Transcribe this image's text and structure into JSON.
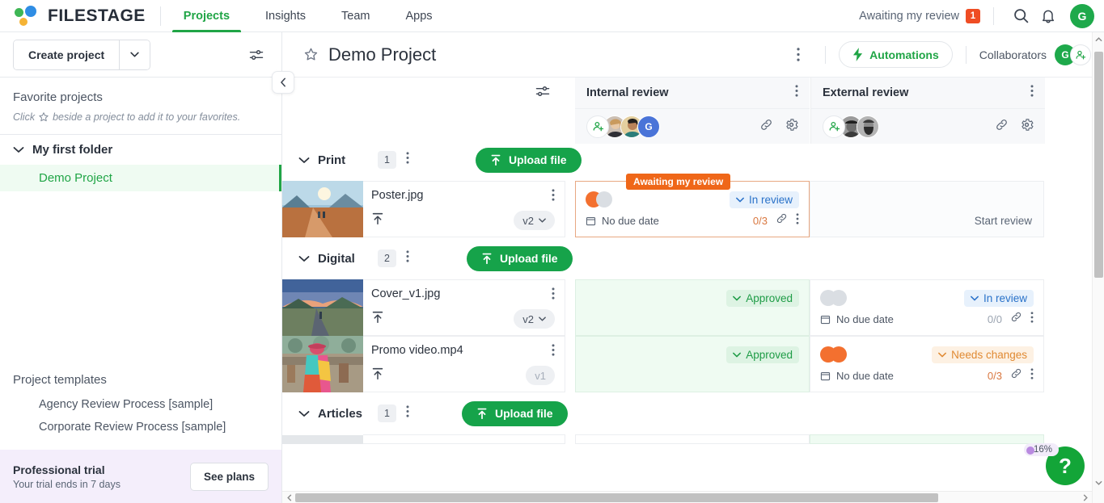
{
  "topbar": {
    "logo_text": "FILESTAGE",
    "nav": [
      {
        "label": "Projects",
        "active": true
      },
      {
        "label": "Insights",
        "active": false
      },
      {
        "label": "Team",
        "active": false
      },
      {
        "label": "Apps",
        "active": false
      }
    ],
    "awaiting_label": "Awaiting my review",
    "awaiting_count": "1",
    "avatar_initial": "G"
  },
  "sidebar": {
    "create_label": "Create project",
    "favorites_title": "Favorite projects",
    "favorites_hint_before": "Click",
    "favorites_hint_after": "beside a project to add it to your favorites.",
    "folder_label": "My first folder",
    "project_label": "Demo Project",
    "templates_title": "Project templates",
    "templates": [
      {
        "label": "Agency Review Process [sample]"
      },
      {
        "label": "Corporate Review Process [sample]"
      }
    ],
    "trial_title": "Professional trial",
    "trial_subtitle": "Your trial ends in 7 days",
    "see_plans_label": "See plans"
  },
  "project": {
    "title": "Demo Project",
    "automations_label": "Automations",
    "collaborators_label": "Collaborators",
    "collaborator_initial": "G"
  },
  "steps": [
    {
      "title": "Internal review",
      "avatar_initial": "G"
    },
    {
      "title": "External review"
    }
  ],
  "sections": [
    {
      "name": "Print",
      "count": "1",
      "upload_label": "Upload file",
      "files": [
        {
          "name": "Poster.jpg",
          "version": "v2",
          "version_disabled": false,
          "thumb": "landscape-desert",
          "internal": {
            "state": "awaiting",
            "tag": "Awaiting my review",
            "pills": [
              "orange",
              "grey"
            ],
            "status": "In review",
            "status_kind": "inreview",
            "due": "No due date",
            "count": "0/3"
          },
          "external": {
            "state": "start",
            "start_label": "Start review"
          }
        }
      ]
    },
    {
      "name": "Digital",
      "count": "2",
      "upload_label": "Upload file",
      "files": [
        {
          "name": "Cover_v1.jpg",
          "version": "v2",
          "version_disabled": false,
          "thumb": "landscape-road",
          "internal": {
            "state": "approved",
            "status": "Approved",
            "status_kind": "approved"
          },
          "external": {
            "state": "normal",
            "pills": [
              "grey",
              "grey"
            ],
            "status": "In review",
            "status_kind": "inreview",
            "due": "No due date",
            "count": "0/0"
          }
        },
        {
          "name": "Promo video.mp4",
          "version": "v1",
          "version_disabled": true,
          "thumb": "crowd-market",
          "internal": {
            "state": "approved",
            "status": "Approved",
            "status_kind": "approved"
          },
          "external": {
            "state": "normal",
            "pills": [
              "orange",
              "orange"
            ],
            "status": "Needs changes",
            "status_kind": "needs",
            "due": "No due date",
            "count": "0/3"
          }
        }
      ]
    },
    {
      "name": "Articles",
      "count": "1",
      "upload_label": "Upload file",
      "files": []
    }
  ],
  "help": {
    "glyph": "?",
    "progress": "16%"
  },
  "colors": {
    "brand_green": "#20a546",
    "upload_green": "#16a34a",
    "awaiting_orange": "#ef6719",
    "badge_red": "#ef4d24",
    "status_blue": "#2a72c9",
    "needs_orange": "#e08a33"
  }
}
